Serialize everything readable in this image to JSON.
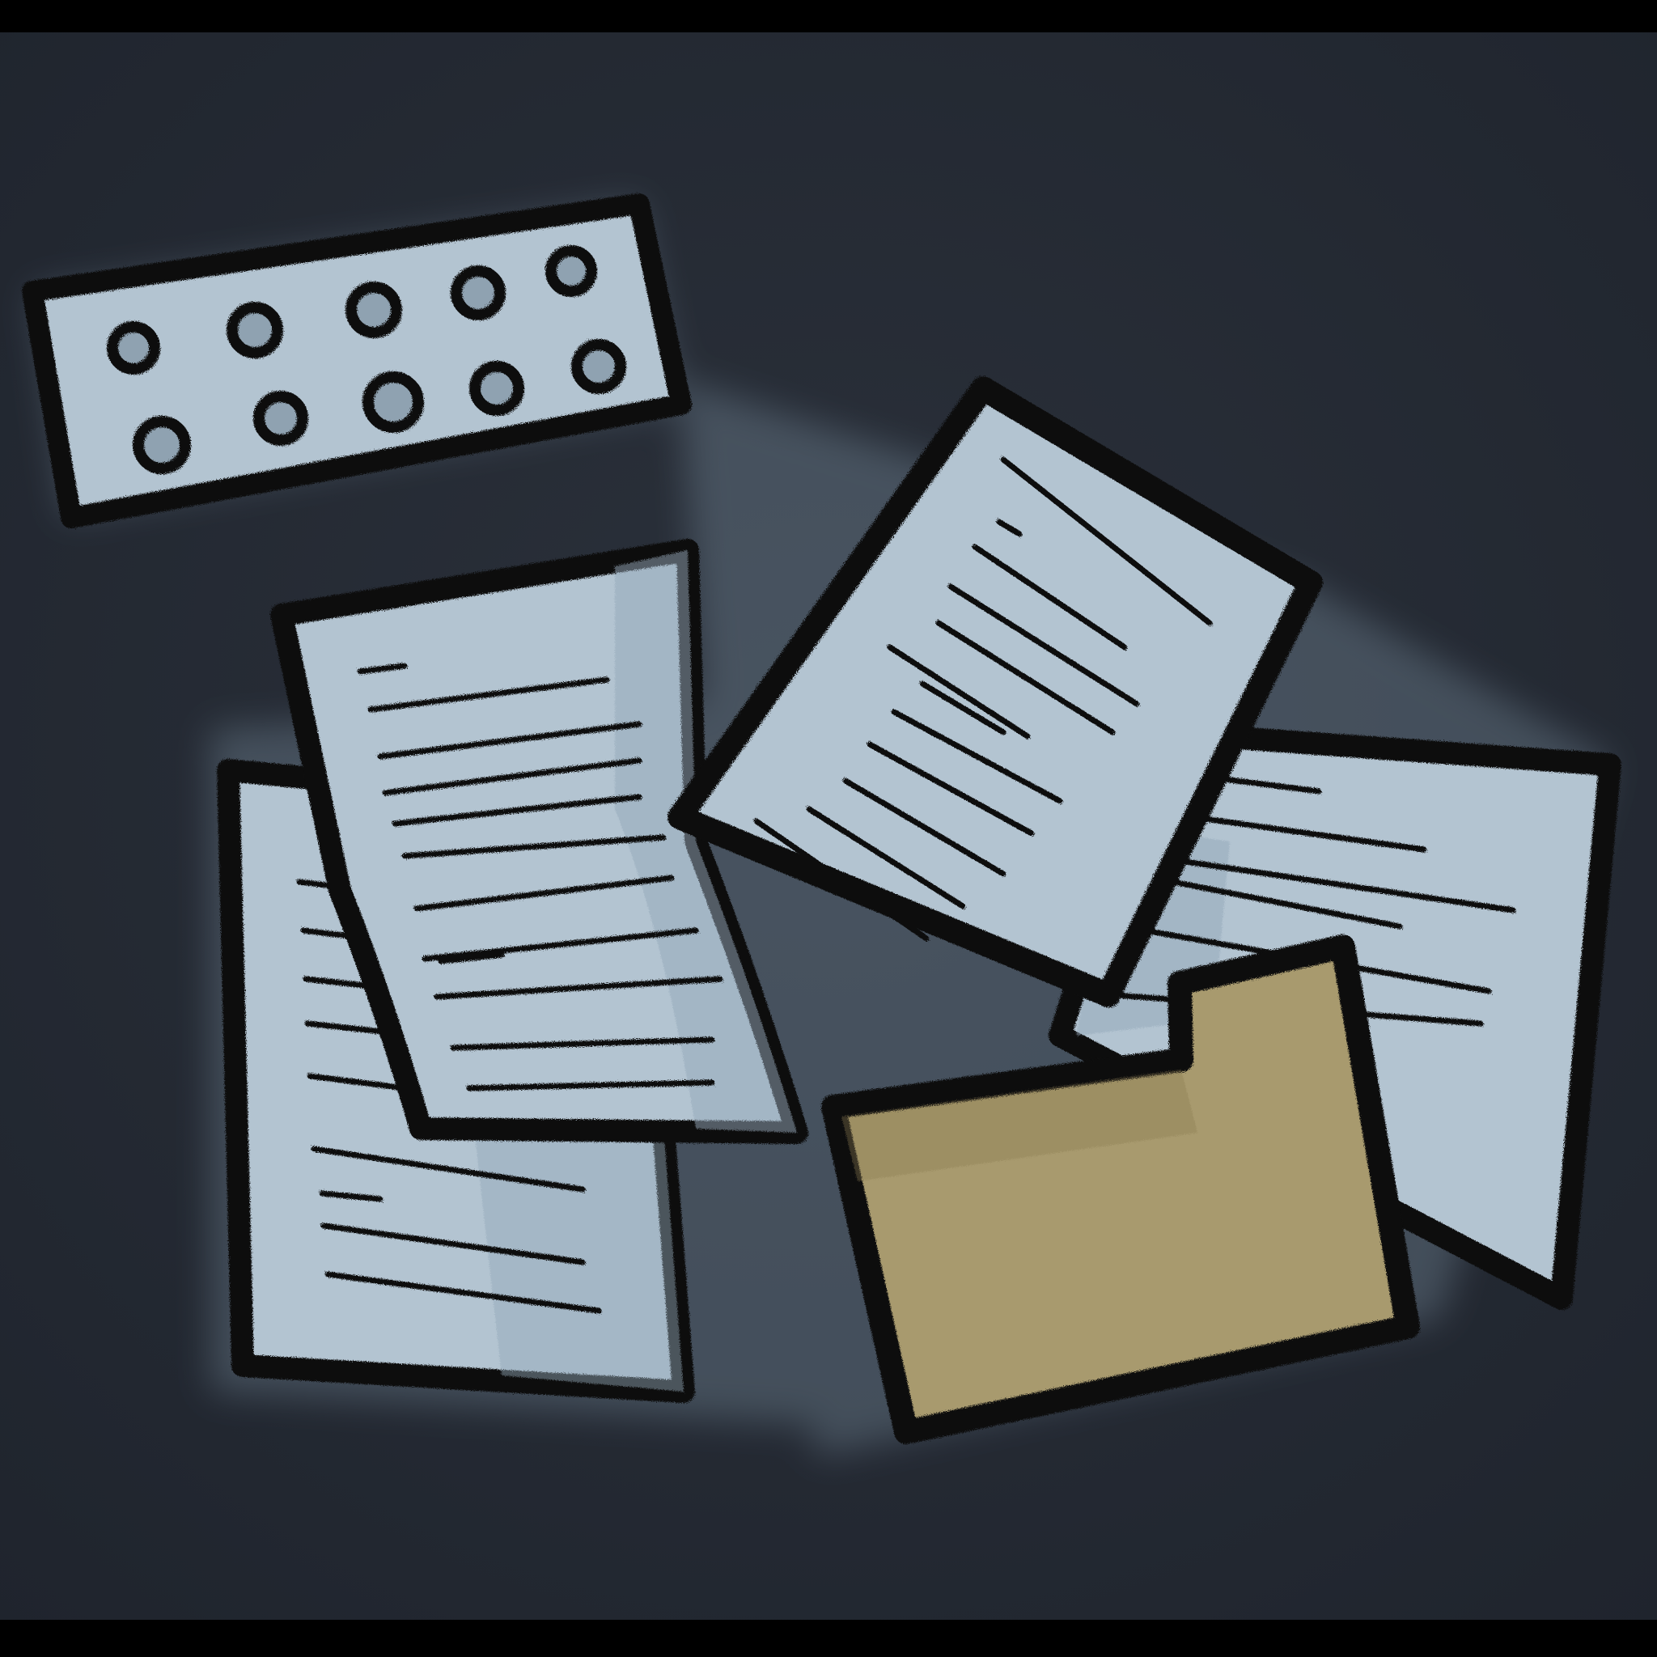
{
  "illustration": {
    "colors": {
      "frame": "#000000",
      "background_center": "#2b313b",
      "background_edge": "#1f242d",
      "paper": "#b3c4d1",
      "paper_shade": "#93a8b9",
      "ink": "#111111",
      "folder": "#a89a6e",
      "folder_dark": "#8a7c52",
      "pill": "#8fa2b1"
    },
    "objects": [
      {
        "name": "pill-blister-pack",
        "icon": "pill-blister-icon",
        "pill_count": 10
      },
      {
        "name": "paper-sheet-back-left",
        "icon": "document-icon"
      },
      {
        "name": "paper-sheet-front-left",
        "icon": "document-icon"
      },
      {
        "name": "paper-sheet-center-tilted",
        "icon": "document-icon"
      },
      {
        "name": "paper-sheet-right",
        "icon": "document-icon"
      },
      {
        "name": "manila-folder",
        "icon": "folder-icon"
      }
    ]
  }
}
